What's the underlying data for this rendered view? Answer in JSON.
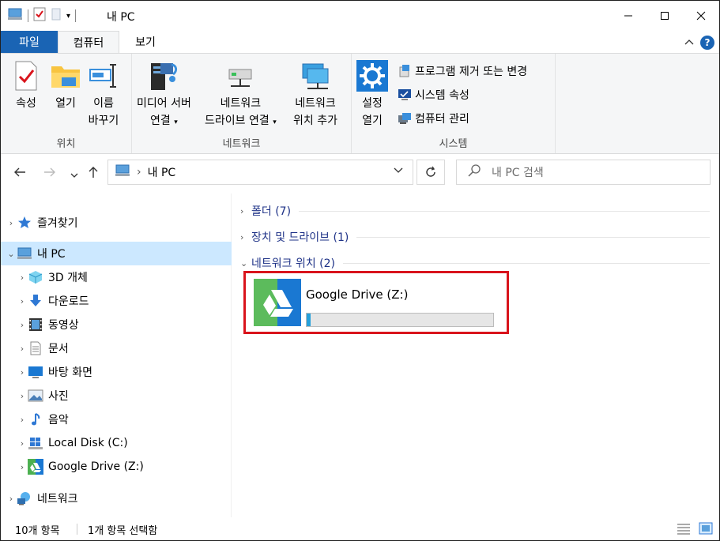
{
  "window": {
    "title": "내 PC"
  },
  "tabs": {
    "file": "파일",
    "computer": "컴퓨터",
    "view": "보기"
  },
  "ribbon": {
    "location": {
      "label": "위치",
      "properties": "속성",
      "open": "열기",
      "rename": [
        "이름",
        "바꾸기"
      ]
    },
    "network": {
      "label": "네트워크",
      "media_server": [
        "미디어 서버",
        "연결"
      ],
      "map_drive": [
        "네트워크",
        "드라이브 연결"
      ],
      "add_location": [
        "네트워크",
        "위치 추가"
      ]
    },
    "system": {
      "label": "시스템",
      "open_settings": [
        "설정",
        "열기"
      ],
      "uninstall": "프로그램 제거 또는 변경",
      "system_properties": "시스템 속성",
      "manage": "컴퓨터 관리"
    }
  },
  "address": {
    "separator": "›",
    "path": "내 PC"
  },
  "search": {
    "placeholder": "내 PC 검색"
  },
  "nav": {
    "quick_access": "즐겨찾기",
    "this_pc": "내 PC",
    "objects3d": "3D 개체",
    "downloads": "다운로드",
    "videos": "동영상",
    "documents": "문서",
    "desktop": "바탕 화면",
    "pictures": "사진",
    "music": "음악",
    "local_disk": "Local Disk (C:)",
    "google_drive": "Google Drive (Z:)",
    "network": "네트워크"
  },
  "content": {
    "folders": "폴더 (7)",
    "devices": "장치 및 드라이브 (1)",
    "network_locations": "네트워크 위치 (2)",
    "drive": {
      "name": "Google Drive (Z:)",
      "used_fraction": 0.02
    }
  },
  "status": {
    "item_count": "10개 항목",
    "selected": "1개 항목 선택함"
  },
  "colors": {
    "accent": "#1a64b4",
    "selection": "#cce8ff",
    "highlight_border": "#d9141c",
    "usage_bar": "#26a0da"
  }
}
